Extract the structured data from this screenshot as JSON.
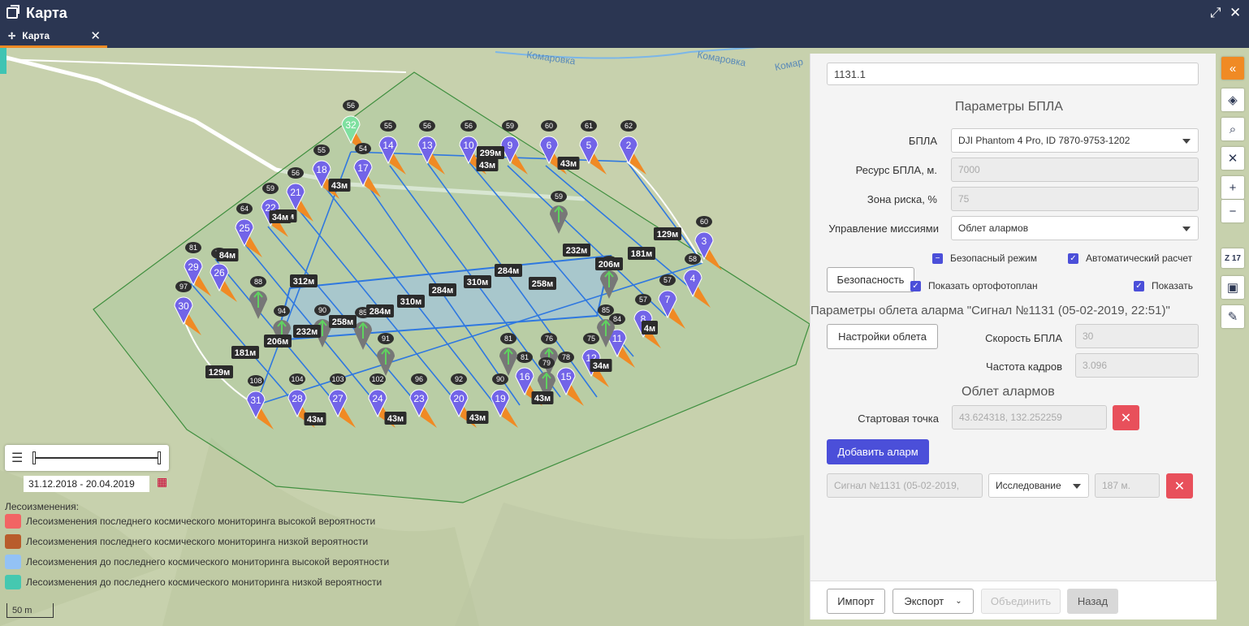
{
  "window": {
    "title": "Карта"
  },
  "tab": {
    "label": "Карта"
  },
  "map": {
    "street_labels": [
      "Комаровка",
      "Комаровка",
      "Комар"
    ],
    "scale_label": "50 m",
    "date_range": "31.12.2018 - 20.04.2019",
    "legend_title": "Лесоизменения:",
    "legend": [
      {
        "label": "Лесоизменения последнего космического мониторинга высокой вероятности",
        "color": "#f26464"
      },
      {
        "label": "Лесоизменения последнего космического мониторинга низкой вероятности",
        "color": "#b85c2b"
      },
      {
        "label": "Лесоизменения до последнего космического мониторинга высокой вероятности",
        "color": "#93c2f5"
      },
      {
        "label": "Лесоизменения до последнего космического мониторинга низкой вероятности",
        "color": "#45c8b0"
      }
    ],
    "waypoints": [
      {
        "n": "32",
        "h": "56",
        "c": "green"
      },
      {
        "n": "14",
        "h": "55"
      },
      {
        "n": "13",
        "h": "56"
      },
      {
        "n": "10",
        "h": "56"
      },
      {
        "n": "9",
        "h": "59"
      },
      {
        "n": "6",
        "h": "60"
      },
      {
        "n": "5",
        "h": "61"
      },
      {
        "n": "2",
        "h": "62"
      },
      {
        "n": "18",
        "h": "55"
      },
      {
        "n": "17",
        "h": "54"
      },
      {
        "n": "21",
        "h": "56"
      },
      {
        "n": "22",
        "h": "59"
      },
      {
        "n": "25",
        "h": "64"
      },
      {
        "n": "26",
        "h": "75"
      },
      {
        "n": "29",
        "h": "81"
      },
      {
        "n": "30",
        "h": "97"
      },
      {
        "n": "3",
        "h": "60"
      },
      {
        "n": "4",
        "h": "58"
      },
      {
        "n": "7",
        "h": "57"
      },
      {
        "n": "8",
        "h": "57"
      },
      {
        "n": "11",
        "h": "84"
      },
      {
        "n": "12",
        "h": "75"
      },
      {
        "n": "15",
        "h": "78"
      },
      {
        "n": "16",
        "h": "81"
      },
      {
        "n": "19",
        "h": "90"
      },
      {
        "n": "20",
        "h": "92"
      },
      {
        "n": "23",
        "h": "96"
      },
      {
        "n": "24",
        "h": "102"
      },
      {
        "n": "27",
        "h": "103"
      },
      {
        "n": "28",
        "h": "104"
      },
      {
        "n": "31",
        "h": "108"
      }
    ],
    "photo_points": [
      {
        "h": "59"
      },
      {
        "h": "88"
      },
      {
        "h": "94"
      },
      {
        "h": "90"
      },
      {
        "h": "85"
      },
      {
        "h": "91"
      },
      {
        "h": "81"
      },
      {
        "h": "76"
      },
      {
        "h": "58"
      },
      {
        "h": "85"
      },
      {
        "h": "79"
      }
    ],
    "distances": [
      "299м",
      "43м",
      "43м",
      "43м",
      "43м",
      "129м",
      "181м",
      "206м",
      "232м",
      "258м",
      "284м",
      "310м",
      "284м",
      "310м",
      "312м",
      "34м",
      "84м",
      "258м",
      "284м",
      "232м",
      "206м",
      "181м",
      "129м",
      "43м",
      "43м",
      "43м",
      "43м",
      "4м",
      "34м",
      "4м"
    ]
  },
  "panel": {
    "search_value": "1131.1",
    "uav_params_title": "Параметры БПЛА",
    "uav_label": "БПЛА",
    "uav_value": "DJI Phantom 4 Pro, ID 7870-9753-1202",
    "resource_label": "Ресурс БПЛА, м.",
    "resource_value": "7000",
    "risk_label": "Зона риска, %",
    "risk_value": "75",
    "mission_label": "Управление миссиями",
    "mission_value": "Облет алармов",
    "safety_button": "Безопасность",
    "safe_mode": "Безопасный режим",
    "auto_calc": "Автоматический расчет",
    "show_ortho": "Показать ортофотоплан",
    "show": "Показать",
    "flight_params_title": "Параметры облета аларма  \"Сигнал №1131 (05-02-2019, 22:51)\"",
    "flight_settings_button": "Настройки облета",
    "speed_label": "Скорость БПЛА",
    "speed_value": "30",
    "frame_label": "Частота кадров",
    "frame_value": "3.096",
    "alarms_title": "Облет алармов",
    "start_label": "Стартовая точка",
    "start_value": "43.624318, 132.252259",
    "add_alarm_button": "Добавить аларм",
    "alarm_name": "Сигнал №1131 (05-02-2019,",
    "alarm_type": "Исследование",
    "alarm_dist": "187 м.",
    "footer": {
      "import": "Импорт",
      "export": "Экспорт",
      "merge": "Объединить",
      "back": "Назад"
    }
  },
  "toolbar": {
    "zoom_level": "Z 17"
  },
  "colors": {
    "accent": "#f08a24",
    "primary": "#4b4fd9",
    "route": "#2f78e0",
    "header": "#2b3652"
  }
}
